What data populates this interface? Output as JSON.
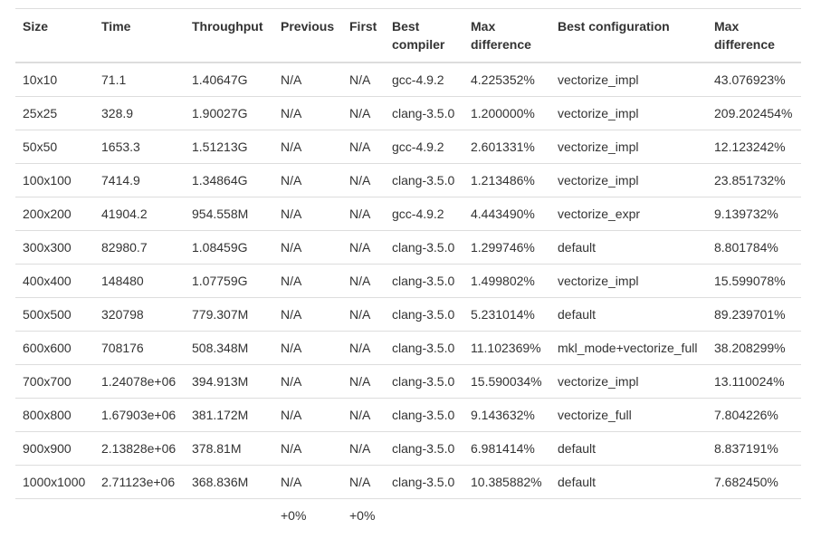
{
  "table": {
    "headers": [
      "Size",
      "Time",
      "Throughput",
      "Previous",
      "First",
      "Best compiler",
      "Max difference",
      "Best configuration",
      "Max difference"
    ],
    "rows": [
      [
        "10x10",
        "71.1",
        "1.40647G",
        "N/A",
        "N/A",
        "gcc-4.9.2",
        "4.225352%",
        "vectorize_impl",
        "43.076923%"
      ],
      [
        "25x25",
        "328.9",
        "1.90027G",
        "N/A",
        "N/A",
        "clang-3.5.0",
        "1.200000%",
        "vectorize_impl",
        "209.202454%"
      ],
      [
        "50x50",
        "1653.3",
        "1.51213G",
        "N/A",
        "N/A",
        "gcc-4.9.2",
        "2.601331%",
        "vectorize_impl",
        "12.123242%"
      ],
      [
        "100x100",
        "7414.9",
        "1.34864G",
        "N/A",
        "N/A",
        "clang-3.5.0",
        "1.213486%",
        "vectorize_impl",
        "23.851732%"
      ],
      [
        "200x200",
        "41904.2",
        "954.558M",
        "N/A",
        "N/A",
        "gcc-4.9.2",
        "4.443490%",
        "vectorize_expr",
        "9.139732%"
      ],
      [
        "300x300",
        "82980.7",
        "1.08459G",
        "N/A",
        "N/A",
        "clang-3.5.0",
        "1.299746%",
        "default",
        "8.801784%"
      ],
      [
        "400x400",
        "148480",
        "1.07759G",
        "N/A",
        "N/A",
        "clang-3.5.0",
        "1.499802%",
        "vectorize_impl",
        "15.599078%"
      ],
      [
        "500x500",
        "320798",
        "779.307M",
        "N/A",
        "N/A",
        "clang-3.5.0",
        "5.231014%",
        "default",
        "89.239701%"
      ],
      [
        "600x600",
        "708176",
        "508.348M",
        "N/A",
        "N/A",
        "clang-3.5.0",
        "11.102369%",
        "mkl_mode+vectorize_full",
        "38.208299%"
      ],
      [
        "700x700",
        "1.24078e+06",
        "394.913M",
        "N/A",
        "N/A",
        "clang-3.5.0",
        "15.590034%",
        "vectorize_impl",
        "13.110024%"
      ],
      [
        "800x800",
        "1.67903e+06",
        "381.172M",
        "N/A",
        "N/A",
        "clang-3.5.0",
        "9.143632%",
        "vectorize_full",
        "7.804226%"
      ],
      [
        "900x900",
        "2.13828e+06",
        "378.81M",
        "N/A",
        "N/A",
        "clang-3.5.0",
        "6.981414%",
        "default",
        "8.837191%"
      ],
      [
        "1000x1000",
        "2.71123e+06",
        "368.836M",
        "N/A",
        "N/A",
        "clang-3.5.0",
        "10.385882%",
        "default",
        "7.682450%"
      ]
    ],
    "footer": [
      "",
      "",
      "",
      "+0%",
      "+0%",
      "",
      "",
      "",
      ""
    ]
  }
}
